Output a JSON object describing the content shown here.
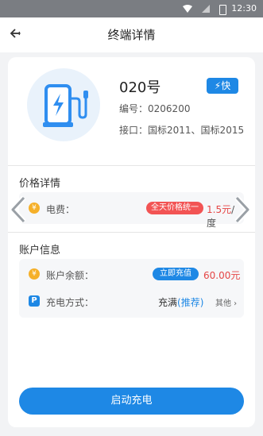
{
  "status_bar": {
    "time": "12:30"
  },
  "header": {
    "title": "终端详情"
  },
  "station": {
    "name": "020号",
    "fast_label": "快",
    "code_label": "编号：",
    "code_value": "0206200",
    "interface_label": "接口：",
    "interface_value": "国标2011、国标2015"
  },
  "price_section": {
    "title": "价格详情",
    "fee_label": "电费：",
    "badge": "全天价格统一",
    "price_value": "1.5元",
    "price_unit": "/度"
  },
  "account_section": {
    "title": "账户信息",
    "balance_label": "账户余额：",
    "recharge_button": "立即充值",
    "balance_value": "60.00元",
    "mode_label": "充电方式：",
    "mode_value": "充满",
    "mode_recommend": "(推荐)",
    "mode_other": "其他"
  },
  "start_button": "启动充电",
  "colors": {
    "accent": "#1e88e5",
    "price_red": "#e54646",
    "badge_red": "#f25454",
    "coin": "#f5b02a"
  }
}
